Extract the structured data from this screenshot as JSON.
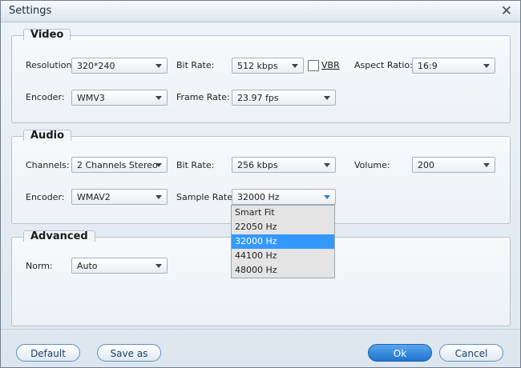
{
  "window": {
    "title": "Settings"
  },
  "video": {
    "title": "Video",
    "resolution": {
      "label": "Resolution:",
      "value": "320*240"
    },
    "bitrate": {
      "label": "Bit Rate:",
      "value": "512 kbps"
    },
    "vbr": {
      "label": "VBR",
      "checked": false
    },
    "aspect": {
      "label": "Aspect Ratio:",
      "value": "16:9"
    },
    "encoder": {
      "label": "Encoder:",
      "value": "WMV3"
    },
    "framerate": {
      "label": "Frame Rate:",
      "value": "23.97 fps"
    }
  },
  "audio": {
    "title": "Audio",
    "channels": {
      "label": "Channels:",
      "value": "2 Channels Stereo"
    },
    "bitrate": {
      "label": "Bit Rate:",
      "value": "256 kbps"
    },
    "volume": {
      "label": "Volume:",
      "value": "200"
    },
    "encoder": {
      "label": "Encoder:",
      "value": "WMAV2"
    },
    "samplerate": {
      "label": "Sample Rate:",
      "value": "32000 Hz",
      "options": [
        "Smart Fit",
        "22050 Hz",
        "32000 Hz",
        "44100 Hz",
        "48000 Hz"
      ],
      "selected_index": 2
    }
  },
  "advanced": {
    "title": "Advanced",
    "norm": {
      "label": "Norm:",
      "value": "Auto"
    }
  },
  "footer": {
    "default_label": "Default",
    "saveas_label": "Save as",
    "ok_label": "Ok",
    "cancel_label": "Cancel"
  },
  "colors": {
    "accent": "#3399ff",
    "primary_button": "#2a7fd6"
  }
}
